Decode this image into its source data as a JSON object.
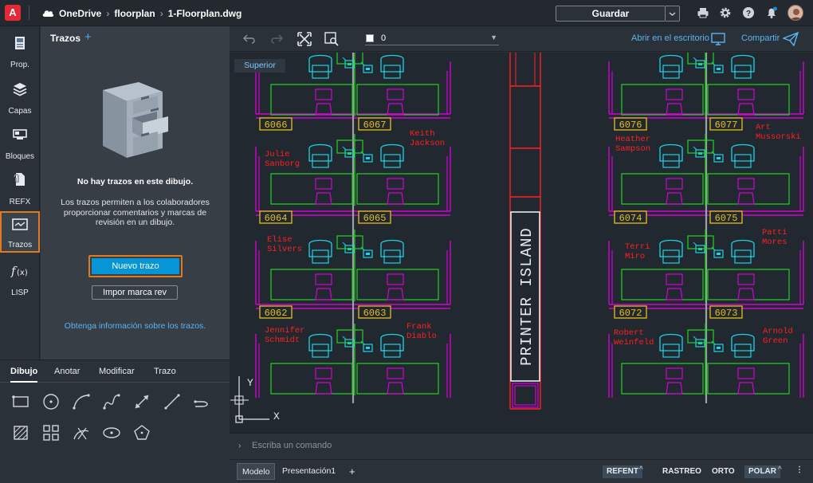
{
  "app": {
    "logo": "A",
    "title": "1-Floorplan.dwg"
  },
  "breadcrumb": {
    "root": "OneDrive",
    "folder": "floorplan",
    "file": "1-Floorplan.dwg"
  },
  "header": {
    "save_label": "Guardar"
  },
  "rail": {
    "items": [
      {
        "label": "Prop.",
        "icon": "properties-icon"
      },
      {
        "label": "Capas",
        "icon": "layers-icon"
      },
      {
        "label": "Bloques",
        "icon": "blocks-icon"
      },
      {
        "label": "REFX",
        "icon": "xref-icon"
      },
      {
        "label": "Trazos",
        "icon": "traces-icon",
        "selected": true
      },
      {
        "label": "LISP",
        "icon": "lisp-icon"
      }
    ]
  },
  "panel": {
    "title": "Trazos",
    "empty_title": "No hay trazos en este dibujo.",
    "empty_desc": "Los trazos permiten a los colaboradores proporcionar comentarios y marcas de revisión en un dibujo.",
    "new_button": "Nuevo trazo",
    "import_button": "Impor marca rev",
    "learn_link": "Obtenga información sobre los trazos."
  },
  "draw_tabs": [
    "Dibujo",
    "Anotar",
    "Modificar",
    "Trazo"
  ],
  "toolbar": {
    "layer_value": "0",
    "open_desktop": "Abrir en el escritorio",
    "share": "Compartir"
  },
  "canvas": {
    "view_badge": "Superior",
    "printer_island": "PRINTER ISLAND",
    "ucs_x": "X",
    "ucs_y": "Y",
    "rooms": [
      "6066",
      "6067",
      "6064",
      "6065",
      "6062",
      "6063",
      "6076",
      "6077",
      "6074",
      "6075",
      "6072",
      "6073"
    ],
    "names": [
      [
        "Keith",
        "Jackson"
      ],
      [
        "Julie",
        "Sanborg"
      ],
      [
        "Elise",
        "Silvers"
      ],
      [
        "Jennifer",
        "Schmidt"
      ],
      [
        "Frank",
        "Diablo"
      ],
      [
        "Heather",
        "Sampson"
      ],
      [
        "Art",
        "Mussorski"
      ],
      [
        "Terri",
        "Miro"
      ],
      [
        "Patti",
        "Mores"
      ],
      [
        "Robert",
        "Weinfeld"
      ],
      [
        "Arnold",
        "Green"
      ]
    ]
  },
  "command": {
    "placeholder": "Escriba un comando"
  },
  "status": {
    "tabs": [
      "Modelo",
      "Presentación1"
    ],
    "add_tab": "+",
    "toggles": [
      "REFENT",
      "RASTREO",
      "ORTO",
      "POLAR"
    ]
  },
  "colors": {
    "accent": "#0696d7",
    "highlight": "#e07a1f",
    "link": "#59b4f5",
    "cad_magenta": "#d400d4",
    "cad_cyan": "#18d4e6",
    "cad_green": "#21d421",
    "cad_yellow": "#e7c019",
    "cad_red": "#ff2020"
  }
}
